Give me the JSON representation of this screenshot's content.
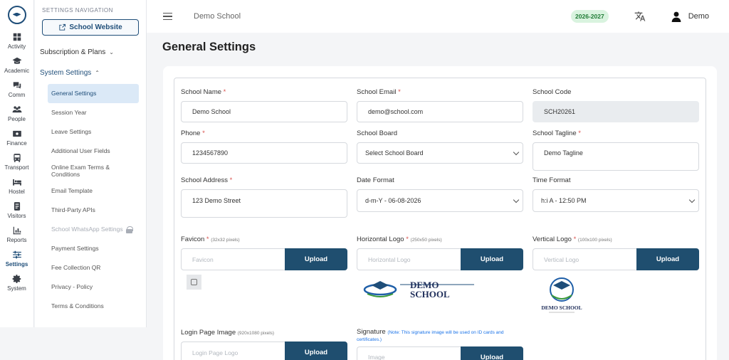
{
  "rail": {
    "items": [
      {
        "label": "Activity",
        "icon": "grid-icon"
      },
      {
        "label": "Academic",
        "icon": "graduation-cap-icon"
      },
      {
        "label": "Comm",
        "icon": "chat-icon"
      },
      {
        "label": "People",
        "icon": "users-icon"
      },
      {
        "label": "Finance",
        "icon": "money-icon"
      },
      {
        "label": "Transport",
        "icon": "bus-icon"
      },
      {
        "label": "Hostel",
        "icon": "bed-icon"
      },
      {
        "label": "Visitors",
        "icon": "id-card-icon"
      },
      {
        "label": "Reports",
        "icon": "chart-icon"
      },
      {
        "label": "Settings",
        "icon": "sliders-icon"
      },
      {
        "label": "System",
        "icon": "gear-icon"
      }
    ]
  },
  "settings_nav": {
    "title": "SETTINGS NAVIGATION",
    "website_button": "School Website",
    "subscription_group": "Subscription & Plans",
    "system_group": "System Settings",
    "items": [
      {
        "label": "General Settings",
        "state": "active"
      },
      {
        "label": "Session Year",
        "state": "normal"
      },
      {
        "label": "Leave Settings",
        "state": "normal"
      },
      {
        "label": "Additional User Fields",
        "state": "normal"
      },
      {
        "label": "Online Exam Terms & Conditions",
        "state": "normal"
      },
      {
        "label": "Email Template",
        "state": "normal"
      },
      {
        "label": "Third-Party APIs",
        "state": "normal"
      },
      {
        "label": "School WhatsApp Settings",
        "state": "disabled"
      },
      {
        "label": "Payment Settings",
        "state": "normal"
      },
      {
        "label": "Fee Collection QR",
        "state": "normal"
      },
      {
        "label": "Privacy - Policy",
        "state": "normal"
      },
      {
        "label": "Terms & Conditions",
        "state": "normal"
      }
    ]
  },
  "header": {
    "school": "Demo School",
    "session_badge": "2026-2027",
    "user": "Demo"
  },
  "page": {
    "title": "General Settings"
  },
  "form": {
    "school_name": {
      "label": "School Name",
      "value": "Demo School"
    },
    "school_email": {
      "label": "School Email",
      "value": "demo@school.com"
    },
    "school_code": {
      "label": "School Code",
      "value": "SCH20261"
    },
    "phone": {
      "label": "Phone",
      "value": "1234567890"
    },
    "school_board": {
      "label": "School Board",
      "value": "Select School Board"
    },
    "school_tagline": {
      "label": "School Tagline",
      "value": "Demo Tagline"
    },
    "school_address": {
      "label": "School Address",
      "value": "123 Demo Street"
    },
    "date_format": {
      "label": "Date Format",
      "value": "d-m-Y - 06-08-2026"
    },
    "time_format": {
      "label": "Time Format",
      "value": "h:i A - 12:50 PM"
    },
    "favicon": {
      "label": "Favicon",
      "hint": "(32x32 pixels)",
      "placeholder": "Favicon"
    },
    "horizontal_logo": {
      "label": "Horizontal Logo",
      "hint": "(250x50 pixels)",
      "placeholder": "Horizontal Logo"
    },
    "vertical_logo": {
      "label": "Vertical Logo",
      "hint": "(100x100 pixels)",
      "placeholder": "Vertical Logo"
    },
    "login_image": {
      "label": "Login Page Image",
      "hint": "(920x1080 pixels)",
      "placeholder": "Login Page Logo"
    },
    "signature": {
      "label": "Signature",
      "note": "(Note: This signature image will be used on ID cards and certificates.)",
      "placeholder": "Image"
    },
    "upload_label": "Upload",
    "required_mark": "*"
  },
  "logos": {
    "line1": "DEMO",
    "line2": "SCHOOL",
    "vertical_text": "DEMO SCHOOL"
  },
  "colors": {
    "brand": "#1f4e79",
    "upload_button": "#1f4e6f",
    "active_nav_bg": "#dbe9f7",
    "badge_bg": "#d9f3df",
    "badge_text": "#1e7b34",
    "required": "#d9534f"
  }
}
